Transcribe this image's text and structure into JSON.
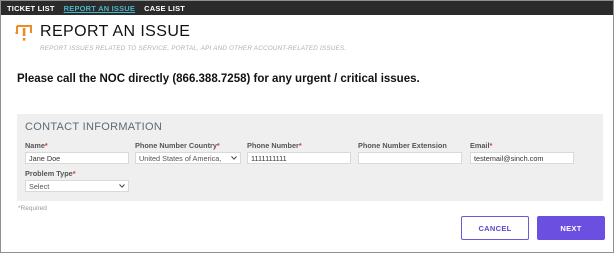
{
  "nav": {
    "items": [
      {
        "label": "TICKET LIST"
      },
      {
        "label": "REPORT AN ISSUE"
      },
      {
        "label": "CASE LIST"
      }
    ]
  },
  "header": {
    "title": "REPORT AN ISSUE",
    "subtitle": "REPORT ISSUES RELATED TO SERVICE, PORTAL, API AND OTHER ACCOUNT-RELATED ISSUES.",
    "icon": "alert-exclamation-icon"
  },
  "notice": "Please call the NOC directly (866.388.7258) for any urgent / critical issues.",
  "form": {
    "section_title": "CONTACT INFORMATION",
    "name": {
      "label": "Name",
      "value": "Jane Doe"
    },
    "phone_country": {
      "label": "Phone Number Country",
      "value": "United States of America,"
    },
    "phone_number": {
      "label": "Phone Number",
      "value": "1111111111"
    },
    "phone_extension": {
      "label": "Phone Number Extension",
      "value": ""
    },
    "email": {
      "label": "Email",
      "value": "testemail@sinch.com"
    },
    "problem_type": {
      "label": "Problem Type",
      "value": "Select"
    },
    "required_marker": "*"
  },
  "required_note": "*Required",
  "buttons": {
    "cancel": "CANCEL",
    "next": "NEXT"
  },
  "colors": {
    "accent": "#6a4fe0",
    "nav_active": "#49b6c8",
    "icon_orange": "#f08a24",
    "required": "#d33a2c"
  }
}
